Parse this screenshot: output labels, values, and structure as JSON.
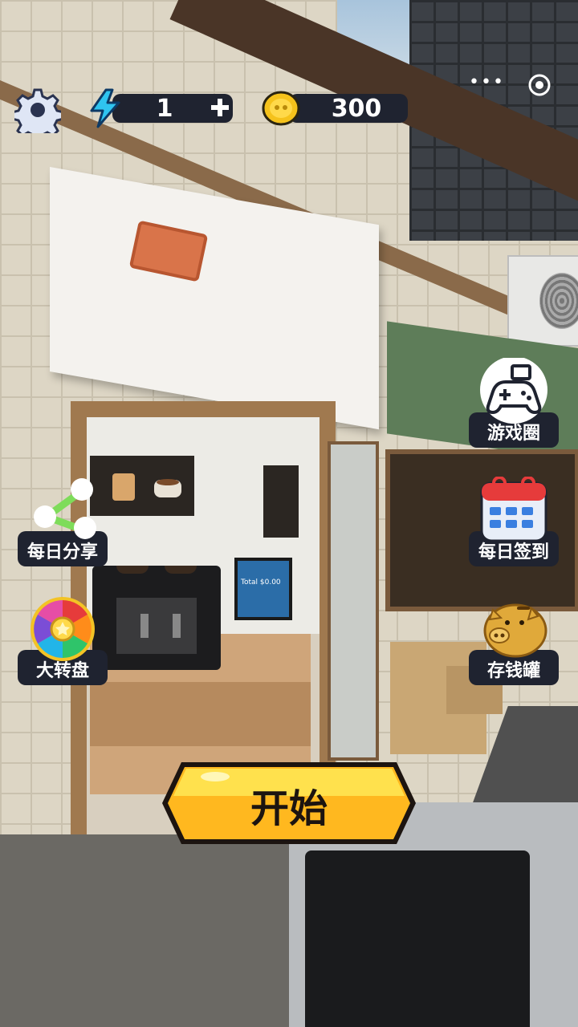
{
  "hud": {
    "energy_value": "1",
    "coin_value": "300"
  },
  "side_buttons": {
    "share": "每日分享",
    "wheel": "大转盘",
    "game_circle": "游戏圈",
    "checkin": "每日签到",
    "piggy": "存钱罐"
  },
  "start_button": {
    "label": "开始"
  },
  "scene_text": {
    "pos_screen": "Total $0.00"
  },
  "colors": {
    "hud_bg": "#1f2330",
    "start_yellow": "#ffd23a",
    "energy_blue": "#2fc4f0",
    "coin_gold": "#f5c21b"
  },
  "icons": [
    "settings-gear-icon",
    "energy-bolt-icon",
    "plus-icon",
    "coin-icon",
    "more-dots-icon",
    "target-icon",
    "share-icon",
    "wheel-icon",
    "gamepad-icon",
    "calendar-icon",
    "piggy-bank-icon"
  ]
}
